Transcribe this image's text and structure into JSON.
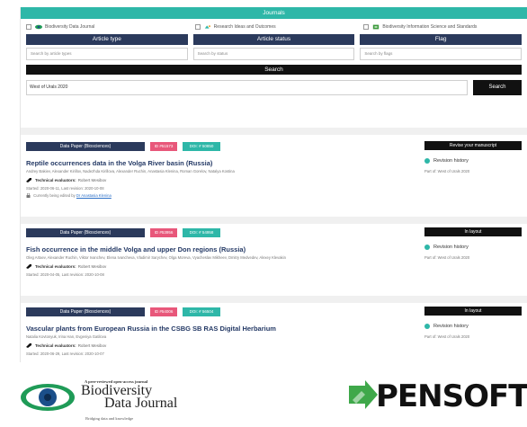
{
  "journals": {
    "title": "Journals",
    "options": [
      {
        "label": "Biodiversity Data Journal",
        "icon": "eye-logo-icon"
      },
      {
        "label": "Research Ideas and Outcomes",
        "icon": "rio-logo-icon"
      },
      {
        "label": "Biodiversity Information Science and Standards",
        "icon": "biss-logo-icon"
      }
    ]
  },
  "filters": [
    {
      "header": "Article type",
      "placeholder": "Search by article types"
    },
    {
      "header": "Article status",
      "placeholder": "Search by status"
    },
    {
      "header": "Flag",
      "placeholder": "Search by flags"
    }
  ],
  "search": {
    "title": "Search",
    "value": "West of Urals 2020",
    "button": "Search"
  },
  "articles": [
    {
      "type": "Data Paper (Biosciences)",
      "id": "ID #51573",
      "doi": "DOI: # 50850",
      "status": "Revise your manuscript",
      "title": "Reptile occurrences data in the Volga River basin (Russia)",
      "authors": "Andrey Bakiev, Alexander Kirillov, Nadezhda Kirillova, Alexander Ruchin, Anastasia Klenina, Roman Gorelov, Natalya Kostina",
      "eval_label": "Technical evaluators:",
      "eval_value": "Robert Mesibov",
      "dates": "Started: 2020-06-11, Last revision: 2020-10-08",
      "editing_prefix": "Currently being edited by",
      "editing_who": "Dr Anastasia Klenina",
      "revision": "Revision history",
      "partof": "Part of: West of Urals 2020"
    },
    {
      "type": "Data Paper (Biosciences)",
      "id": "ID #53956",
      "doi": "DOI: # 54958",
      "status": "In layout",
      "title": "Fish occurrence in the middle Volga and upper Don regions (Russia)",
      "authors": "Oleg Artaev, Alexander Ruchin, Viktor Ivanchev, Elena Ivancheva, Vladimir Sarychev, Olga Moreva, Vyacheslav Mikheev, Dmitry Medvedev, Alexey Klevakin",
      "eval_label": "Technical evaluators:",
      "eval_value": "Robert Mesibov",
      "dates": "Started: 2020-04-05, Last revision: 2020-10-08",
      "editing_prefix": "",
      "editing_who": "",
      "revision": "Revision history",
      "partof": "Part of: West of Urals 2020"
    },
    {
      "type": "Data Paper (Biosciences)",
      "id": "ID #54006",
      "doi": "DOI: # 56504",
      "status": "In layout",
      "title": "Vascular plants from European Russia in the CSBG SB RAS Digital Herbarium",
      "authors": "Natalia Kovtonyuk, Irina Han, Evgeniya Gatilova",
      "eval_label": "Technical evaluators:",
      "eval_value": "Robert Mesibov",
      "dates": "Started: 2020-06-29, Last revision: 2020-10-07",
      "editing_prefix": "",
      "editing_who": "",
      "revision": "Revision history",
      "partof": "Part of: West of Urals 2020"
    }
  ],
  "footer": {
    "bdj_tagline": "A peer-reviewed open-access journal",
    "bdj_line1": "Biodiversity",
    "bdj_line2": "Data Journal",
    "bdj_sub": "Bridging data and knowledge",
    "pensoft": "PENSOFT"
  },
  "colors": {
    "teal": "#2eb7a8",
    "navy": "#2b3a5c",
    "pink": "#e8577a",
    "black": "#111111",
    "title_blue": "#253a66"
  }
}
